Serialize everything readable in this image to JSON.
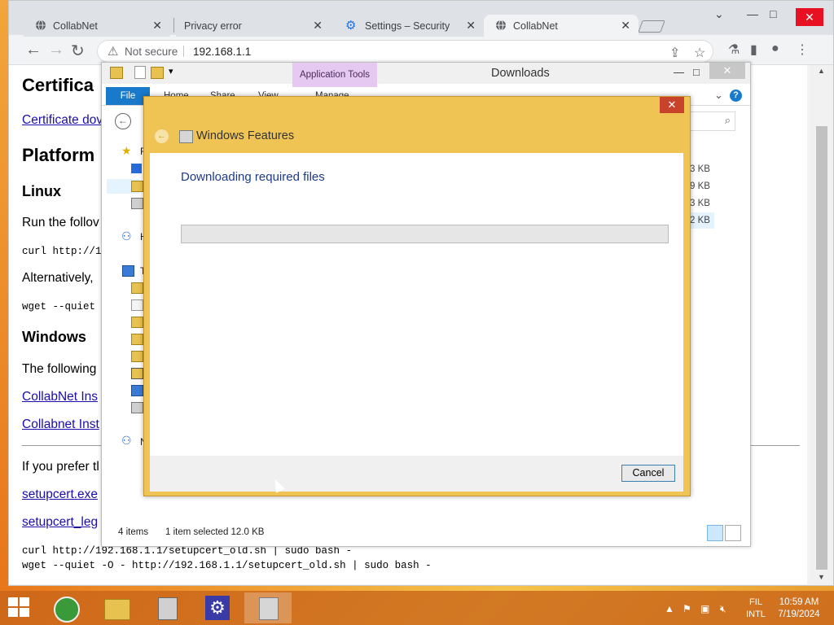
{
  "browser": {
    "tabs": [
      {
        "title": "CollabNet",
        "icon": "globe-icon",
        "active": false
      },
      {
        "title": "Privacy error",
        "icon": "none",
        "active": false
      },
      {
        "title": "Settings – Security",
        "icon": "gear-icon",
        "active": false
      },
      {
        "title": "CollabNet",
        "icon": "globe-icon",
        "active": true
      }
    ],
    "omnibox": {
      "security_label": "Not secure",
      "url": "192.168.1.1"
    }
  },
  "page": {
    "heading_cert": "Certifica",
    "link_cert_download": "Certificate dov",
    "heading_platform": "Platform",
    "heading_linux": "Linux",
    "linux_text": "Run the follov",
    "linux_code1": "curl http://19",
    "linux_alt": "Alternatively,",
    "linux_code2": "wget --quiet -",
    "heading_windows": "Windows",
    "windows_text": "The following",
    "link_installer1": "CollabNet Ins",
    "link_installer2": "Collabnet Inst",
    "prefer_text": "If you prefer tl",
    "link_setupcert": "setupcert.exe",
    "link_setupcert_legacy": "setupcert_leg",
    "code_curl_old": "curl http://192.168.1.1/setupcert_old.sh | sudo bash -",
    "code_wget_old": "wget --quiet -O - http://192.168.1.1/setupcert_old.sh | sudo bash -"
  },
  "explorer": {
    "title": "Downloads",
    "context_tab": "Application Tools",
    "ribbon_tabs": [
      "File",
      "Home",
      "Share",
      "View",
      "Manage"
    ],
    "sizes": [
      "3 KB",
      "9 KB",
      "3 KB",
      "2 KB"
    ],
    "nav_partial": [
      "F",
      "H",
      "T",
      "N"
    ],
    "status_items": "4 items",
    "status_selected": "1 item selected  12.0 KB"
  },
  "dialog": {
    "title": "Windows Features",
    "message": "Downloading required files",
    "progress": 0,
    "cancel_label": "Cancel"
  },
  "taskbar": {
    "lang_top": "FIL",
    "lang_bottom": "INTL",
    "time": "10:59 AM",
    "date": "7/19/2024"
  },
  "colors": {
    "accent_blue": "#1979ca",
    "dialog_frame": "#f0c454",
    "context_tab": "#e6c9f0",
    "desktop_orange": "#e8761a"
  }
}
